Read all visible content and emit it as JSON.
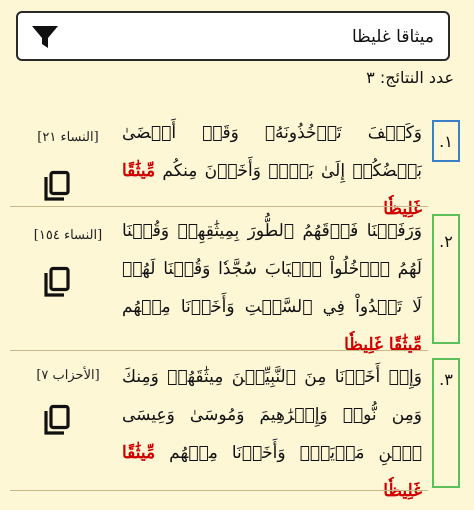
{
  "search": {
    "value": "ميثاقا غليظا",
    "filter_icon": "filter-icon"
  },
  "results_count": "عدد النتائج: ٣",
  "results": [
    {
      "number": ".١",
      "verse_before": "وَكَيۡفَ تَأۡخُذُونَهُۥ وَقَدۡ أَفۡضَىٰ بَعۡضُكُمۡ إِلَىٰ بَعۡضٖ وَأَخَذۡنَ مِنكُم ",
      "highlight": "مِّيثَٰقًا غَلِيظٗا",
      "reference": "[النساء ٢١]",
      "copy_icon": "copy-icon"
    },
    {
      "number": ".٢",
      "verse_before": "وَرَفَعۡنَا فَوۡقَهُمُ ٱلطُّورَ بِمِيثَٰقِهِمۡ وَقُلۡنَا لَهُمُ ٱدۡخُلُواْ ٱلۡبَابَ سُجَّدٗا وَقُلۡنَا لَهُمۡ لَا تَعۡدُواْ فِي ٱلسَّبۡتِ وَأَخَذۡنَا مِنۡهُم ",
      "highlight": "مِّيثَٰقًا غَلِيظٗا",
      "reference": "[النساء ١٥٤]",
      "copy_icon": "copy-icon"
    },
    {
      "number": ".٣",
      "verse_before": "وَإِذۡ أَخَذۡنَا مِنَ ٱلنَّبِيِّـۧنَ مِيثَٰقَهُمۡ وَمِنكَ وَمِن نُّوحٖ وَإِبۡرَٰهِيمَ وَمُوسَىٰ وَعِيسَى ٱبۡنِ مَرۡيَمَۖ وَأَخَذۡنَا مِنۡهُم ",
      "highlight": "مِّيثَٰقًا غَلِيظٗا",
      "reference": "[الأحزاب ٧]",
      "copy_icon": "copy-icon"
    }
  ],
  "colors": {
    "background": "#fdf7d6",
    "highlight": "#d00000",
    "badge_blue": "#3a7fc8",
    "badge_green": "#5bbf5b"
  }
}
